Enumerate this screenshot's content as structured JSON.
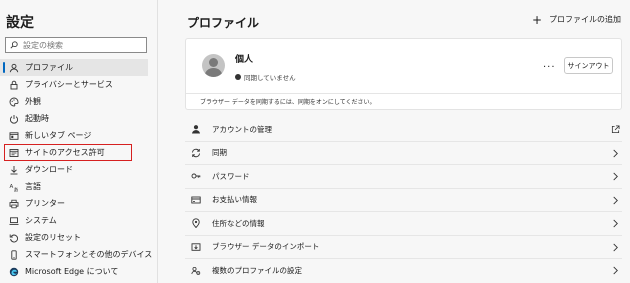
{
  "sidebar": {
    "title": "設定",
    "search_placeholder": "設定の検索",
    "items": [
      {
        "label": "プロファイル",
        "icon": "profile-icon"
      },
      {
        "label": "プライバシーとサービス",
        "icon": "lock-icon"
      },
      {
        "label": "外観",
        "icon": "palette-icon"
      },
      {
        "label": "起動時",
        "icon": "power-icon"
      },
      {
        "label": "新しいタブ ページ",
        "icon": "new-tab-icon"
      },
      {
        "label": "サイトのアクセス許可",
        "icon": "site-permissions-icon"
      },
      {
        "label": "ダウンロード",
        "icon": "download-icon"
      },
      {
        "label": "言語",
        "icon": "language-icon"
      },
      {
        "label": "プリンター",
        "icon": "printer-icon"
      },
      {
        "label": "システム",
        "icon": "computer-icon"
      },
      {
        "label": "設定のリセット",
        "icon": "reset-icon"
      },
      {
        "label": "スマートフォンとその他のデバイス",
        "icon": "phone-icon"
      },
      {
        "label": "Microsoft Edge について",
        "icon": "edge-logo-icon"
      }
    ],
    "selected_index": 0,
    "highlighted_index": 5
  },
  "main": {
    "title": "プロファイル",
    "add_profile": "プロファイルの追加",
    "profile": {
      "name": "個人",
      "status": "同期していません",
      "more": "···",
      "signin": "サインアウト",
      "sync_note": "ブラウザー データを同期するには、同期をオンにしてください。"
    },
    "rows": [
      {
        "label": "アカウントの管理",
        "icon": "person-icon",
        "trail": "external-link-icon"
      },
      {
        "label": "同期",
        "icon": "sync-icon",
        "trail": "chevron-right-icon"
      },
      {
        "label": "パスワード",
        "icon": "key-icon",
        "trail": "chevron-right-icon"
      },
      {
        "label": "お支払い情報",
        "icon": "credit-card-icon",
        "trail": "chevron-right-icon"
      },
      {
        "label": "住所などの情報",
        "icon": "location-icon",
        "trail": "chevron-right-icon"
      },
      {
        "label": "ブラウザー データのインポート",
        "icon": "import-icon",
        "trail": "chevron-right-icon"
      },
      {
        "label": "複数のプロファイルの設定",
        "icon": "multi-profile-icon",
        "trail": "chevron-right-icon"
      }
    ]
  },
  "colors": {
    "accent": "#0067c0",
    "highlight_box": "#d62020",
    "background": "#f7f7f7"
  }
}
